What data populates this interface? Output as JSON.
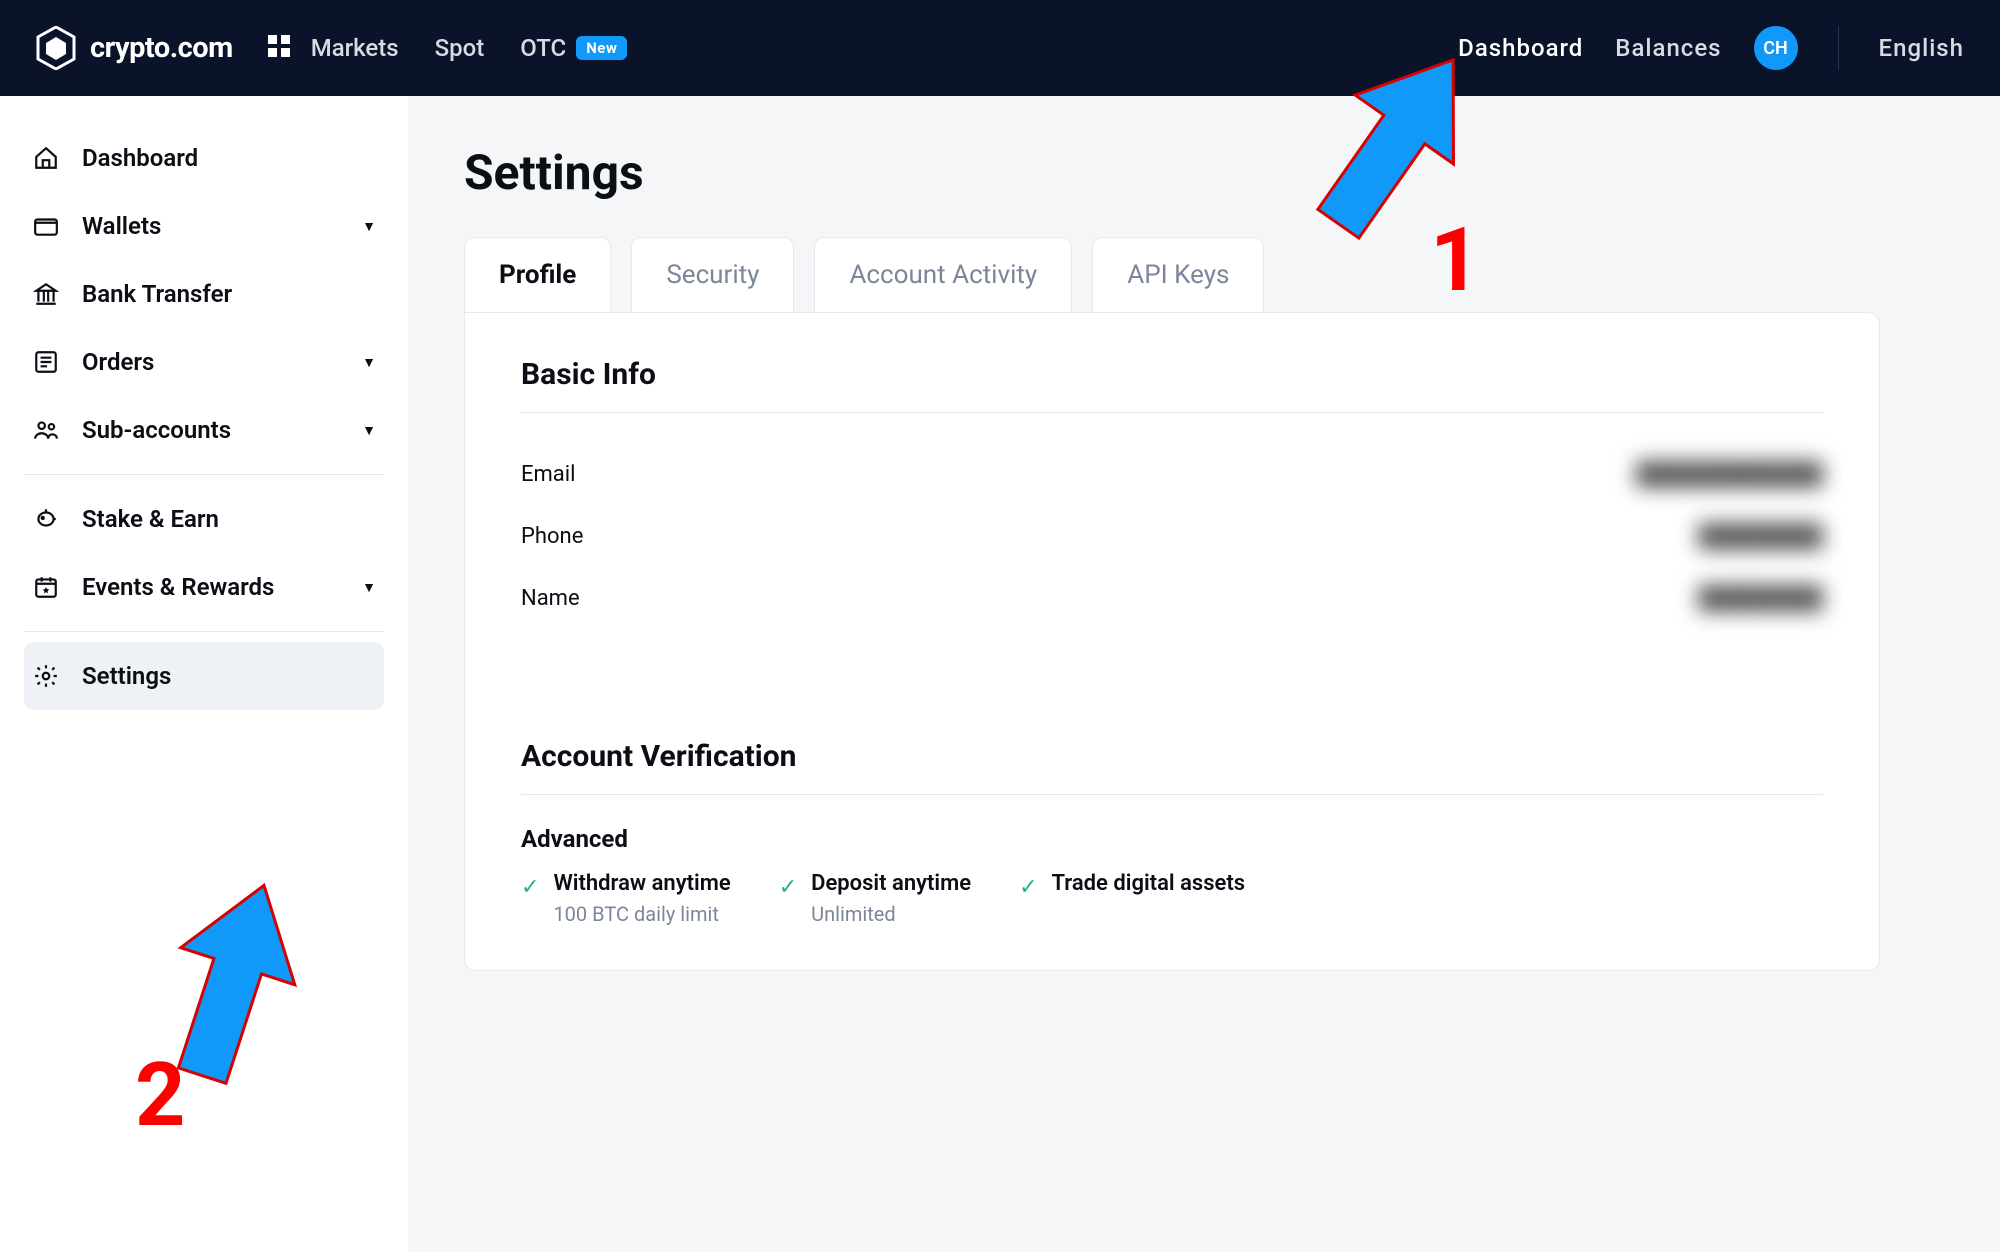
{
  "brand": {
    "name": "crypto.com"
  },
  "topnav": {
    "left": [
      {
        "label": "Markets"
      },
      {
        "label": "Spot"
      },
      {
        "label": "OTC",
        "badge": "New"
      }
    ],
    "right": {
      "dashboard": "Dashboard",
      "balances": "Balances",
      "avatar": "CH",
      "language": "English"
    }
  },
  "sidebar": {
    "items": [
      {
        "label": "Dashboard",
        "icon": "home"
      },
      {
        "label": "Wallets",
        "icon": "wallet",
        "chev": true
      },
      {
        "label": "Bank Transfer",
        "icon": "bank"
      },
      {
        "label": "Orders",
        "icon": "orders",
        "chev": true
      },
      {
        "label": "Sub-accounts",
        "icon": "subaccounts",
        "chev": true
      },
      {
        "divider": true
      },
      {
        "label": "Stake & Earn",
        "icon": "piggy"
      },
      {
        "label": "Events & Rewards",
        "icon": "calendar",
        "chev": true
      },
      {
        "divider": true
      },
      {
        "label": "Settings",
        "icon": "gear",
        "active": true
      }
    ]
  },
  "page": {
    "title": "Settings",
    "tabs": [
      {
        "label": "Profile",
        "active": true
      },
      {
        "label": "Security"
      },
      {
        "label": "Account Activity"
      },
      {
        "label": "API Keys"
      }
    ],
    "basic": {
      "title": "Basic Info",
      "rows": [
        {
          "label": "Email",
          "value": "████████████"
        },
        {
          "label": "Phone",
          "value": "████████"
        },
        {
          "label": "Name",
          "value": "████████"
        }
      ]
    },
    "verification": {
      "title": "Account Verification",
      "level": "Advanced",
      "features": [
        {
          "label": "Withdraw anytime",
          "sub": "100 BTC daily limit"
        },
        {
          "label": "Deposit anytime",
          "sub": "Unlimited"
        },
        {
          "label": "Trade digital assets",
          "sub": ""
        }
      ]
    }
  },
  "annotations": {
    "one": "1",
    "two": "2"
  }
}
